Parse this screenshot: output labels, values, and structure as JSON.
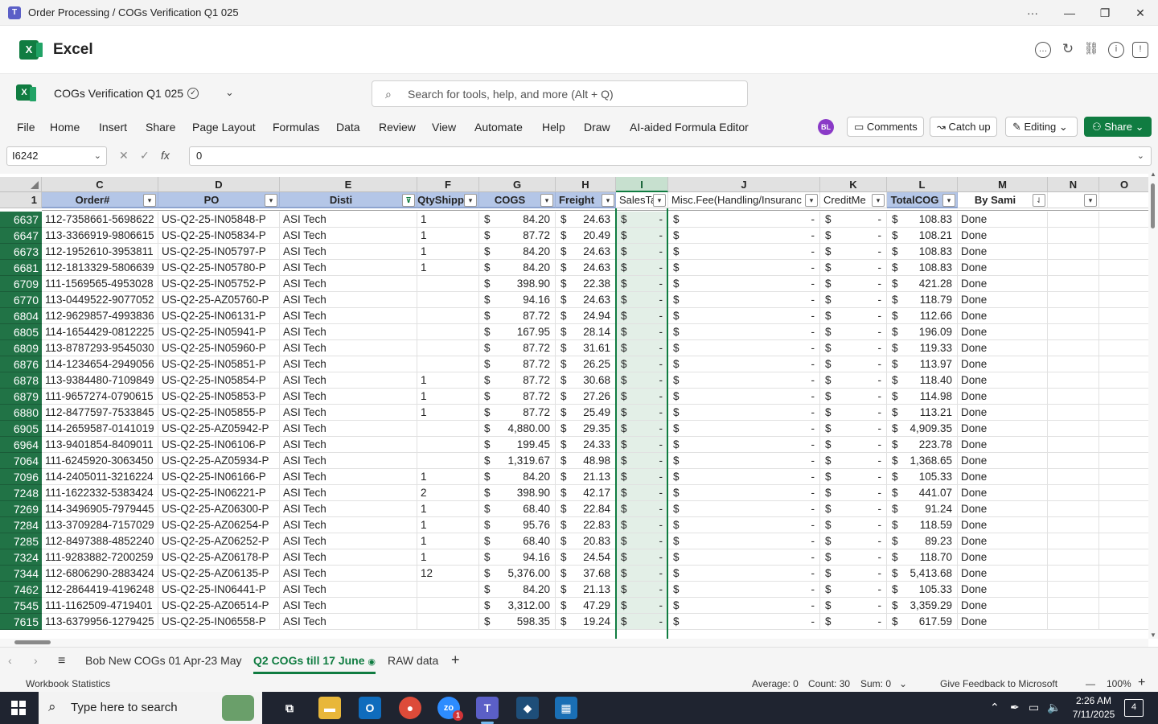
{
  "window": {
    "title": "Order Processing / COGs Verification Q1 025"
  },
  "app": {
    "name": "Excel"
  },
  "doc": {
    "name": "COGs Verification Q1 025"
  },
  "search": {
    "placeholder": "Search for tools, help, and more (Alt + Q)"
  },
  "menu": [
    "File",
    "Home",
    "Insert",
    "Share",
    "Page Layout",
    "Formulas",
    "Data",
    "Review",
    "View",
    "Automate",
    "Help",
    "Draw",
    "AI-aided Formula Editor"
  ],
  "user": {
    "initials": "BL"
  },
  "toolbar": {
    "comments": "Comments",
    "catchup": "Catch up",
    "editing": "Editing",
    "share": "Share"
  },
  "formula": {
    "namebox": "I6242",
    "value": "0"
  },
  "columns": {
    "letters": [
      "C",
      "D",
      "E",
      "F",
      "G",
      "H",
      "I",
      "J",
      "K",
      "L",
      "M",
      "N",
      "O"
    ],
    "header_row_number": "1",
    "headers": [
      "Order#",
      "PO",
      "Disti",
      "QtyShipp",
      "COGS",
      "Freight",
      "SalesTa",
      "Misc.Fee(Handling/Insuranc",
      "CreditMe",
      "TotalCOG",
      "By Sami",
      "",
      ""
    ]
  },
  "rows": [
    {
      "n": "6637",
      "order": "112-7358661-5698622",
      "po": "US-Q2-25-IN05848-P",
      "disti": "ASI Tech",
      "qty": "1",
      "cogs": "84.20",
      "freight": "24.63",
      "tax": "-",
      "misc": "-",
      "credit": "-",
      "total": "108.83",
      "by": "Done"
    },
    {
      "n": "6647",
      "order": "113-3366919-9806615",
      "po": "US-Q2-25-IN05834-P",
      "disti": "ASI Tech",
      "qty": "1",
      "cogs": "87.72",
      "freight": "20.49",
      "tax": "-",
      "misc": "-",
      "credit": "-",
      "total": "108.21",
      "by": "Done"
    },
    {
      "n": "6673",
      "order": "112-1952610-3953811",
      "po": "US-Q2-25-IN05797-P",
      "disti": "ASI Tech",
      "qty": "1",
      "cogs": "84.20",
      "freight": "24.63",
      "tax": "-",
      "misc": "-",
      "credit": "-",
      "total": "108.83",
      "by": "Done"
    },
    {
      "n": "6681",
      "order": "112-1813329-5806639",
      "po": "US-Q2-25-IN05780-P",
      "disti": "ASI Tech",
      "qty": "1",
      "cogs": "84.20",
      "freight": "24.63",
      "tax": "-",
      "misc": "-",
      "credit": "-",
      "total": "108.83",
      "by": "Done"
    },
    {
      "n": "6709",
      "order": "111-1569565-4953028",
      "po": "US-Q2-25-IN05752-P",
      "disti": "ASI Tech",
      "qty": "",
      "cogs": "398.90",
      "freight": "22.38",
      "tax": "-",
      "misc": "-",
      "credit": "-",
      "total": "421.28",
      "by": "Done"
    },
    {
      "n": "6770",
      "order": "113-0449522-9077052",
      "po": "US-Q2-25-AZ05760-P",
      "disti": "ASI Tech",
      "qty": "",
      "cogs": "94.16",
      "freight": "24.63",
      "tax": "-",
      "misc": "-",
      "credit": "-",
      "total": "118.79",
      "by": "Done"
    },
    {
      "n": "6804",
      "order": "112-9629857-4993836",
      "po": "US-Q2-25-IN06131-P",
      "disti": "ASI Tech",
      "qty": "",
      "cogs": "87.72",
      "freight": "24.94",
      "tax": "-",
      "misc": "-",
      "credit": "-",
      "total": "112.66",
      "by": "Done"
    },
    {
      "n": "6805",
      "order": "114-1654429-0812225",
      "po": "US-Q2-25-IN05941-P",
      "disti": "ASI Tech",
      "qty": "",
      "cogs": "167.95",
      "freight": "28.14",
      "tax": "-",
      "misc": "-",
      "credit": "-",
      "total": "196.09",
      "by": "Done"
    },
    {
      "n": "6809",
      "order": "113-8787293-9545030",
      "po": "US-Q2-25-IN05960-P",
      "disti": "ASI Tech",
      "qty": "",
      "cogs": "87.72",
      "freight": "31.61",
      "tax": "-",
      "misc": "-",
      "credit": "-",
      "total": "119.33",
      "by": "Done"
    },
    {
      "n": "6876",
      "order": "114-1234654-2949056",
      "po": "US-Q2-25-IN05851-P",
      "disti": "ASI Tech",
      "qty": "",
      "cogs": "87.72",
      "freight": "26.25",
      "tax": "-",
      "misc": "-",
      "credit": "-",
      "total": "113.97",
      "by": "Done"
    },
    {
      "n": "6878",
      "order": "113-9384480-7109849",
      "po": "US-Q2-25-IN05854-P",
      "disti": "ASI Tech",
      "qty": "1",
      "cogs": "87.72",
      "freight": "30.68",
      "tax": "-",
      "misc": "-",
      "credit": "-",
      "total": "118.40",
      "by": "Done"
    },
    {
      "n": "6879",
      "order": "111-9657274-0790615",
      "po": "US-Q2-25-IN05853-P",
      "disti": "ASI Tech",
      "qty": "1",
      "cogs": "87.72",
      "freight": "27.26",
      "tax": "-",
      "misc": "-",
      "credit": "-",
      "total": "114.98",
      "by": "Done"
    },
    {
      "n": "6880",
      "order": "112-8477597-7533845",
      "po": "US-Q2-25-IN05855-P",
      "disti": "ASI Tech",
      "qty": "1",
      "cogs": "87.72",
      "freight": "25.49",
      "tax": "-",
      "misc": "-",
      "credit": "-",
      "total": "113.21",
      "by": "Done"
    },
    {
      "n": "6905",
      "order": "114-2659587-0141019",
      "po": "US-Q2-25-AZ05942-P",
      "disti": "ASI Tech",
      "qty": "",
      "cogs": "4,880.00",
      "freight": "29.35",
      "tax": "-",
      "misc": "-",
      "credit": "-",
      "total": "4,909.35",
      "by": "Done"
    },
    {
      "n": "6964",
      "order": "113-9401854-8409011",
      "po": "US-Q2-25-IN06106-P",
      "disti": "ASI Tech",
      "qty": "",
      "cogs": "199.45",
      "freight": "24.33",
      "tax": "-",
      "misc": "-",
      "credit": "-",
      "total": "223.78",
      "by": "Done"
    },
    {
      "n": "7064",
      "order": "111-6245920-3063450",
      "po": "US-Q2-25-AZ05934-P",
      "disti": "ASI Tech",
      "qty": "",
      "cogs": "1,319.67",
      "freight": "48.98",
      "tax": "-",
      "misc": "-",
      "credit": "-",
      "total": "1,368.65",
      "by": "Done"
    },
    {
      "n": "7096",
      "order": "114-2405011-3216224",
      "po": "US-Q2-25-IN06166-P",
      "disti": "ASI Tech",
      "qty": "1",
      "cogs": "84.20",
      "freight": "21.13",
      "tax": "-",
      "misc": "-",
      "credit": "-",
      "total": "105.33",
      "by": "Done"
    },
    {
      "n": "7248",
      "order": "111-1622332-5383424",
      "po": "US-Q2-25-IN06221-P",
      "disti": "ASI Tech",
      "qty": "2",
      "cogs": "398.90",
      "freight": "42.17",
      "tax": "-",
      "misc": "-",
      "credit": "-",
      "total": "441.07",
      "by": "Done"
    },
    {
      "n": "7269",
      "order": "114-3496905-7979445",
      "po": "US-Q2-25-AZ06300-P",
      "disti": "ASI Tech",
      "qty": "1",
      "cogs": "68.40",
      "freight": "22.84",
      "tax": "-",
      "misc": "-",
      "credit": "-",
      "total": "91.24",
      "by": "Done"
    },
    {
      "n": "7284",
      "order": "113-3709284-7157029",
      "po": "US-Q2-25-AZ06254-P",
      "disti": "ASI Tech",
      "qty": "1",
      "cogs": "95.76",
      "freight": "22.83",
      "tax": "-",
      "misc": "-",
      "credit": "-",
      "total": "118.59",
      "by": "Done"
    },
    {
      "n": "7285",
      "order": "112-8497388-4852240",
      "po": "US-Q2-25-AZ06252-P",
      "disti": "ASI Tech",
      "qty": "1",
      "cogs": "68.40",
      "freight": "20.83",
      "tax": "-",
      "misc": "-",
      "credit": "-",
      "total": "89.23",
      "by": "Done"
    },
    {
      "n": "7324",
      "order": "111-9283882-7200259",
      "po": "US-Q2-25-AZ06178-P",
      "disti": "ASI Tech",
      "qty": "1",
      "cogs": "94.16",
      "freight": "24.54",
      "tax": "-",
      "misc": "-",
      "credit": "-",
      "total": "118.70",
      "by": "Done"
    },
    {
      "n": "7344",
      "order": "112-6806290-2883424",
      "po": "US-Q2-25-AZ06135-P",
      "disti": "ASI Tech",
      "qty": "12",
      "cogs": "5,376.00",
      "freight": "37.68",
      "tax": "-",
      "misc": "-",
      "credit": "-",
      "total": "5,413.68",
      "by": "Done"
    },
    {
      "n": "7462",
      "order": "112-2864419-4196248",
      "po": "US-Q2-25-IN06441-P",
      "disti": "ASI Tech",
      "qty": "",
      "cogs": "84.20",
      "freight": "21.13",
      "tax": "-",
      "misc": "-",
      "credit": "-",
      "total": "105.33",
      "by": "Done"
    },
    {
      "n": "7545",
      "order": "111-1162509-4719401",
      "po": "US-Q2-25-AZ06514-P",
      "disti": "ASI Tech",
      "qty": "",
      "cogs": "3,312.00",
      "freight": "47.29",
      "tax": "-",
      "misc": "-",
      "credit": "-",
      "total": "3,359.29",
      "by": "Done"
    },
    {
      "n": "7615",
      "order": "113-6379956-1279425",
      "po": "US-Q2-25-IN06558-P",
      "disti": "ASI Tech",
      "qty": "",
      "cogs": "598.35",
      "freight": "19.24",
      "tax": "-",
      "misc": "-",
      "credit": "-",
      "total": "617.59",
      "by": "Done"
    }
  ],
  "currency_symbol": "$",
  "sheets": {
    "tabs": [
      "Bob New COGs 01 Apr-23 May",
      "Q2 COGs till 17 June",
      "RAW data"
    ],
    "active_index": 1,
    "add_label": "+"
  },
  "status": {
    "left": "Workbook Statistics",
    "average": "Average: 0",
    "count": "Count: 30",
    "sum": "Sum: 0",
    "feedback": "Give Feedback to Microsoft",
    "zoom": "100%"
  },
  "taskbar": {
    "search_placeholder": "Type here to search",
    "time": "2:26 AM",
    "date": "7/11/2025",
    "notification_count": "4",
    "zoom_badge": "1"
  },
  "colors": {
    "excel_green": "#107c41",
    "header_blue": "#b4c6e7",
    "row_header_green": "#217346"
  }
}
